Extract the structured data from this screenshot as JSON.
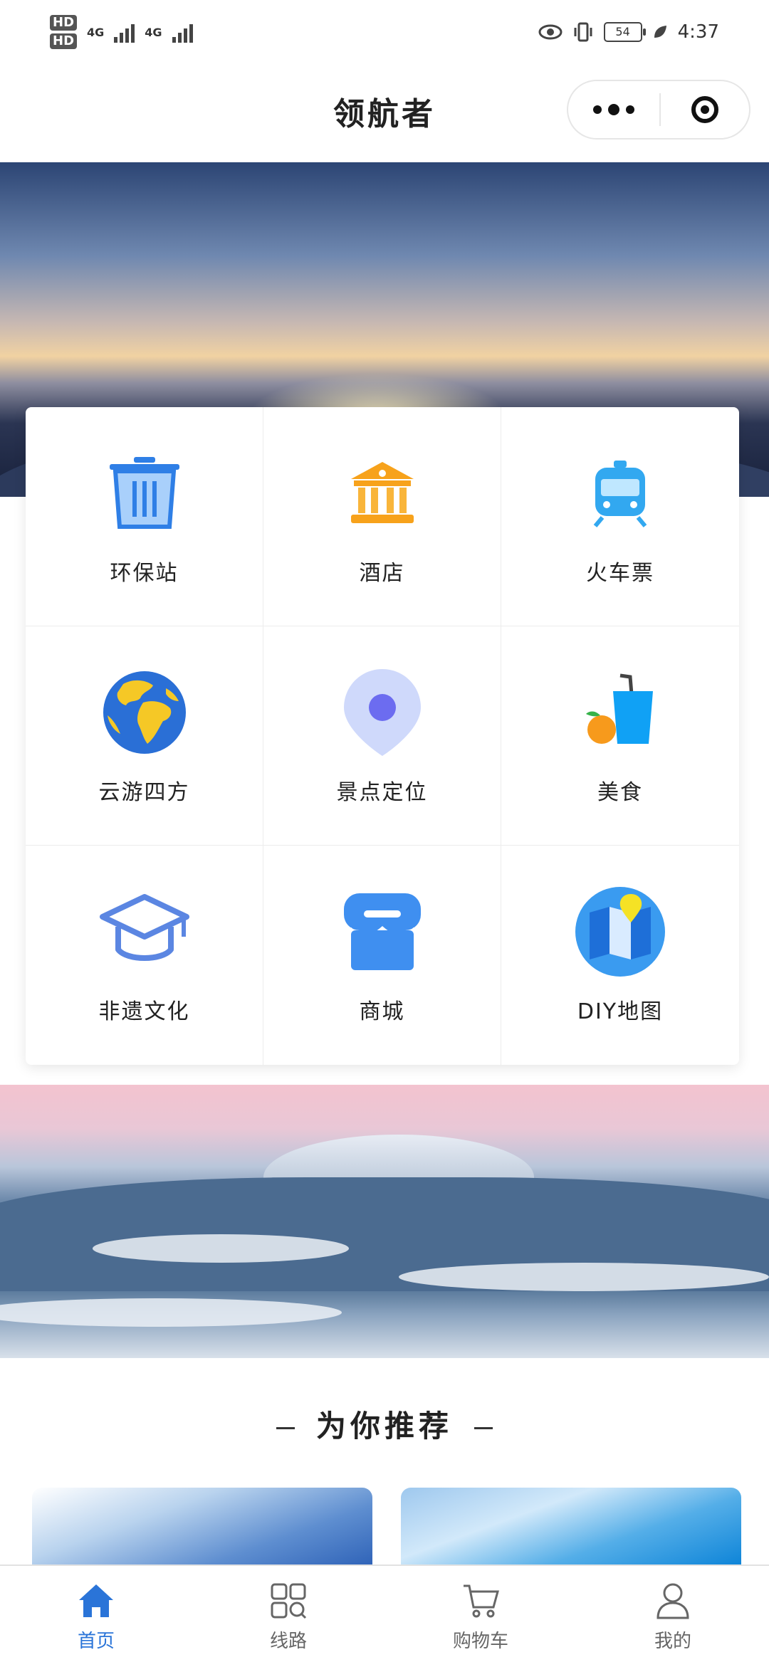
{
  "status_bar": {
    "hd1": "HD",
    "hd2": "HD",
    "net1": "4G",
    "net2": "4G",
    "battery": "54",
    "time": "4:37"
  },
  "header": {
    "title": "领航者"
  },
  "menu": {
    "items": [
      {
        "label": "环保站",
        "icon": "trash-bin-icon"
      },
      {
        "label": "酒店",
        "icon": "hotel-building-icon"
      },
      {
        "label": "火车票",
        "icon": "train-icon"
      },
      {
        "label": "云游四方",
        "icon": "globe-icon"
      },
      {
        "label": "景点定位",
        "icon": "location-pin-icon"
      },
      {
        "label": "美食",
        "icon": "food-drink-icon"
      },
      {
        "label": "非遗文化",
        "icon": "graduation-cap-icon"
      },
      {
        "label": "商城",
        "icon": "store-icon"
      },
      {
        "label": "DIY地图",
        "icon": "map-icon"
      }
    ]
  },
  "recommend": {
    "title": "为你推荐"
  },
  "tabbar": {
    "items": [
      {
        "label": "首页",
        "icon": "home-icon",
        "active": true
      },
      {
        "label": "线路",
        "icon": "grid-search-icon",
        "active": false
      },
      {
        "label": "购物车",
        "icon": "cart-icon",
        "active": false
      },
      {
        "label": "我的",
        "icon": "user-icon",
        "active": false
      }
    ]
  },
  "colors": {
    "accent": "#2a74d8",
    "icon_blue": "#3f8ff0",
    "hotel_orange": "#f7a21b",
    "globe_yellow": "#f5c826"
  }
}
